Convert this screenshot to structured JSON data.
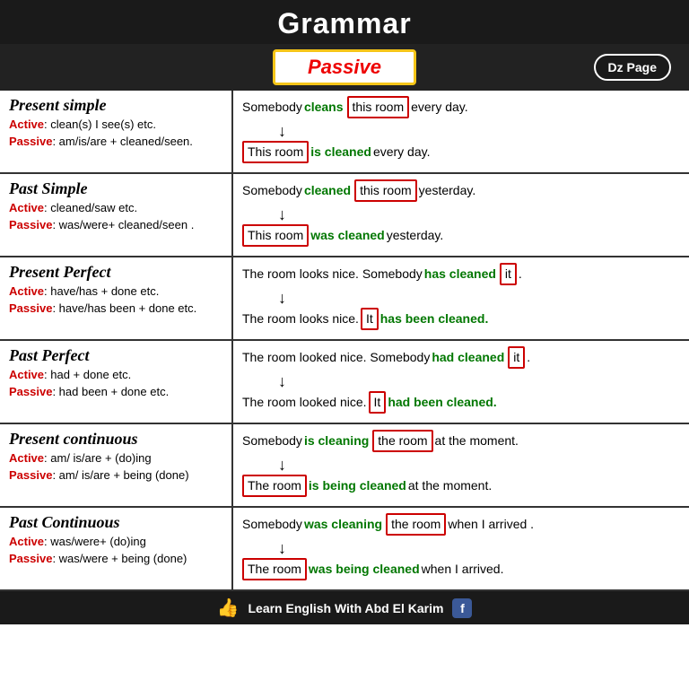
{
  "header": {
    "title": "Grammar"
  },
  "passive_badge": {
    "label": "Passive"
  },
  "dz_page": {
    "label": "Dz Page"
  },
  "sections": [
    {
      "id": "present-simple",
      "title": "Present simple",
      "active_label": "Active",
      "active_text": ": clean(s) I see(s) etc.",
      "passive_label": "Passive",
      "passive_text": ": am/is/are + cleaned/seen.",
      "example1": {
        "parts": [
          "Somebody ",
          "cleans",
          " ",
          "this room",
          " every day."
        ],
        "green": [
          1
        ],
        "boxed": [
          3
        ]
      },
      "example2": {
        "parts": [
          "This room",
          " is cleaned",
          " every day."
        ],
        "boxed_start": true,
        "green": [
          1
        ]
      }
    },
    {
      "id": "past-simple",
      "title": "Past Simple",
      "active_label": "Active",
      "active_text": ": cleaned/saw etc.",
      "passive_label": "Passive",
      "passive_text": ": was/were+ cleaned/seen .",
      "example1": {
        "parts": [
          "Somebody ",
          "cleaned",
          " ",
          "this room",
          " yesterday."
        ],
        "green": [
          1
        ],
        "boxed": [
          3
        ]
      },
      "example2": {
        "parts": [
          "This room",
          " was cleaned",
          " yesterday."
        ],
        "boxed_start": true,
        "green": [
          1
        ]
      }
    },
    {
      "id": "present-perfect",
      "title": "Present Perfect",
      "active_label": "Active",
      "active_text": ": have/has + done etc.",
      "passive_label": "Passive",
      "passive_text": ": have/has been + done etc.",
      "example1": {
        "parts": [
          "The room looks nice. Somebody ",
          "has cleaned",
          " ",
          "it",
          "."
        ],
        "green": [
          1
        ],
        "boxed": [
          3
        ]
      },
      "example2": {
        "parts": [
          "The room looks nice. ",
          "It",
          " has been cleaned."
        ],
        "boxed": [
          1
        ],
        "green_after": [
          2
        ]
      }
    },
    {
      "id": "past-perfect",
      "title": "Past Perfect",
      "active_label": "Active",
      "active_text": ": had + done etc.",
      "passive_label": "Passive",
      "passive_text": ": had been + done etc.",
      "example1": {
        "parts": [
          "The room looked nice. Somebody ",
          "had cleaned",
          " ",
          "it",
          "."
        ],
        "green": [
          1
        ],
        "boxed": [
          3
        ]
      },
      "example2": {
        "parts": [
          "The room looked nice. ",
          "It",
          " had been cleaned."
        ],
        "boxed": [
          1
        ],
        "green_after": [
          2
        ]
      }
    },
    {
      "id": "present-continuous",
      "title": "Present continuous",
      "active_label": "Active",
      "active_text": ": am/ is/are + (do)ing",
      "passive_label": "Passive",
      "passive_text": ": am/ is/are + being (done)",
      "example1": {
        "parts": [
          "Somebody ",
          "is cleaning",
          " ",
          "the room",
          " at the moment."
        ],
        "green": [
          1
        ],
        "boxed": [
          3
        ]
      },
      "example2": {
        "parts": [
          "The room",
          " is being cleaned",
          " at the moment."
        ],
        "boxed_start": true,
        "green": [
          1
        ]
      }
    },
    {
      "id": "past-continuous",
      "title": "Past Continuous",
      "active_label": "Active",
      "active_text": ": was/were+ (do)ing",
      "passive_label": "Passive",
      "passive_text": ": was/were + being (done)",
      "example1": {
        "parts": [
          "Somebody ",
          "was cleaning",
          " ",
          "the room",
          " when I arrived ."
        ],
        "green": [
          1
        ],
        "boxed": [
          3
        ]
      },
      "example2": {
        "parts": [
          "The room",
          " was being cleaned",
          " when I arrived."
        ],
        "boxed_start": true,
        "green": [
          1
        ]
      }
    }
  ],
  "footer": {
    "thumb": "👍",
    "text": "Learn English With Abd El Karim",
    "fb": "f"
  }
}
